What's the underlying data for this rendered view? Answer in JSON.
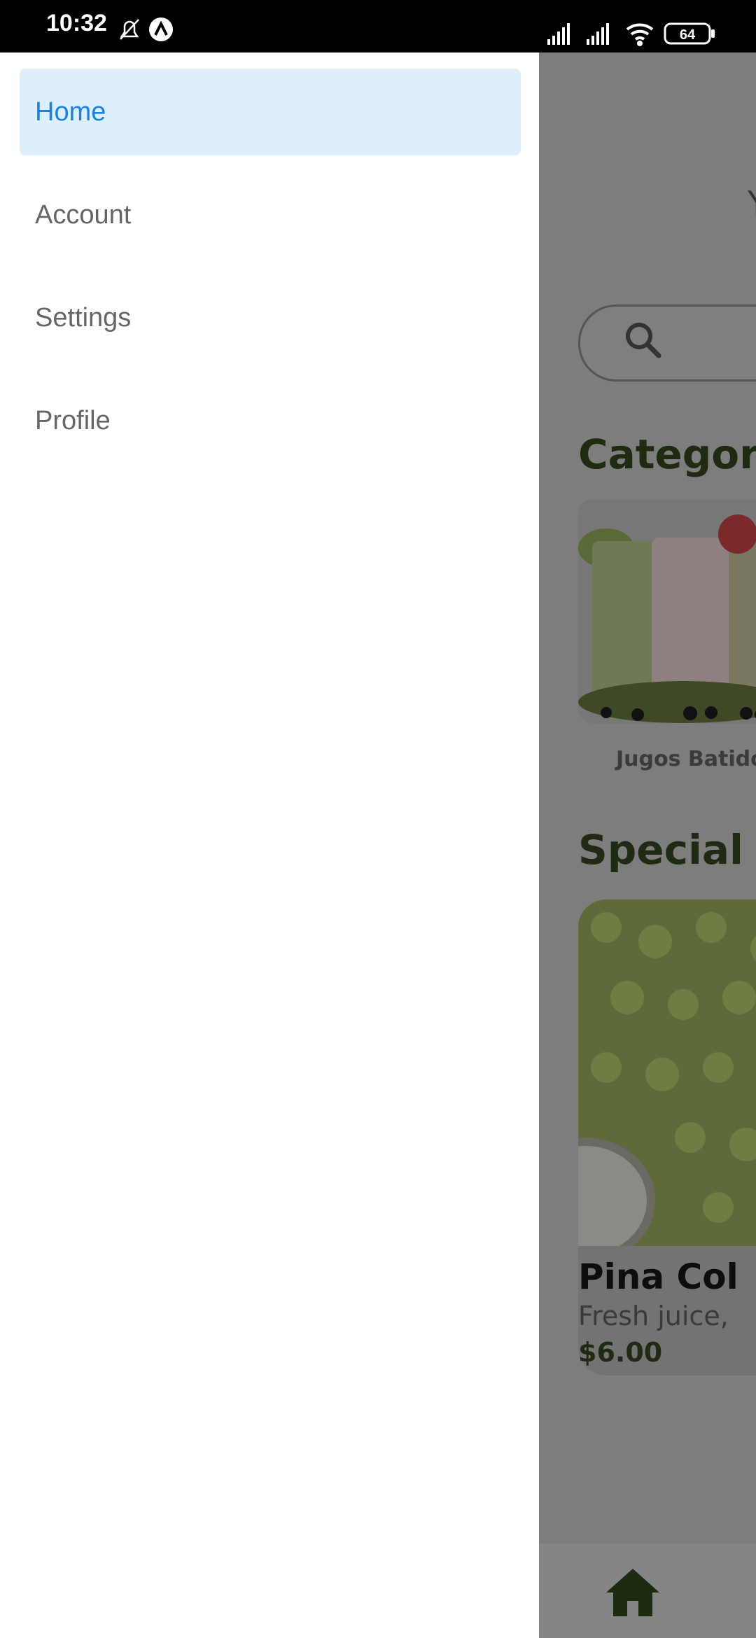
{
  "status_bar": {
    "time": "10:32",
    "battery": "64"
  },
  "drawer": {
    "items": [
      {
        "label": "Home",
        "active": true
      },
      {
        "label": "Account",
        "active": false
      },
      {
        "label": "Settings",
        "active": false
      },
      {
        "label": "Profile",
        "active": false
      }
    ]
  },
  "app": {
    "categories_title": "Category",
    "category_label": "Jugos Batido",
    "special_title": "Special O",
    "special": {
      "name": "Pina Col",
      "description": "Fresh juice,",
      "price": "$6.00"
    }
  },
  "colors": {
    "drawer_active_bg": "#ddeefd",
    "drawer_active_text": "#1a82d9",
    "scrim": "#7a7a7a"
  }
}
